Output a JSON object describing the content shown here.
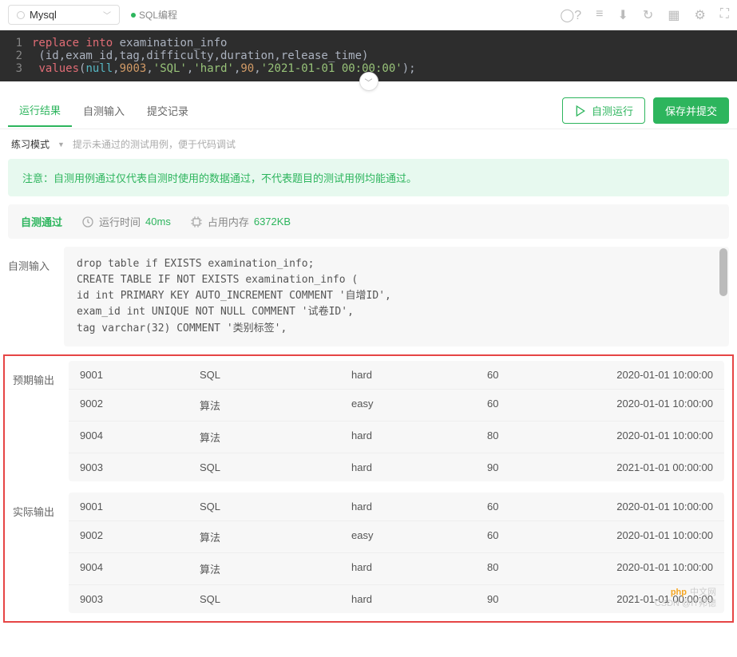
{
  "topbar": {
    "db_select": "Mysql",
    "lang_label": "SQL编程"
  },
  "editor": {
    "lines": [
      {
        "n": "1",
        "parts": [
          {
            "t": "replace",
            "c": "kw-red"
          },
          {
            "t": " ",
            "c": "plain"
          },
          {
            "t": "into",
            "c": "kw-red"
          },
          {
            "t": " examination_info",
            "c": "plain"
          }
        ]
      },
      {
        "n": "2",
        "parts": [
          {
            "t": " (id,exam_id,tag,difficulty,duration,release_time)",
            "c": "plain"
          }
        ]
      },
      {
        "n": "3",
        "parts": [
          {
            "t": " ",
            "c": "plain"
          },
          {
            "t": "values",
            "c": "kw-red"
          },
          {
            "t": "(",
            "c": "plain"
          },
          {
            "t": "null",
            "c": "kw-cyan"
          },
          {
            "t": ",",
            "c": "plain"
          },
          {
            "t": "9003",
            "c": "kw-orange"
          },
          {
            "t": ",",
            "c": "plain"
          },
          {
            "t": "'SQL'",
            "c": "kw-green"
          },
          {
            "t": ",",
            "c": "plain"
          },
          {
            "t": "'hard'",
            "c": "kw-green"
          },
          {
            "t": ",",
            "c": "plain"
          },
          {
            "t": "90",
            "c": "kw-orange"
          },
          {
            "t": ",",
            "c": "plain"
          },
          {
            "t": "'2021-01-01 00:00:00'",
            "c": "kw-green"
          },
          {
            "t": ");",
            "c": "plain"
          }
        ]
      }
    ]
  },
  "tabs": {
    "t1": "运行结果",
    "t2": "自测输入",
    "t3": "提交记录",
    "btn_run": "自测运行",
    "btn_submit": "保存并提交"
  },
  "mode": {
    "label": "练习模式",
    "hint": "提示未通过的测试用例，便于代码调试"
  },
  "notice": "注意：自测用例通过仅代表自测时使用的数据通过，不代表题目的测试用例均能通过。",
  "status": {
    "pass": "自测通过",
    "time_label": "运行时间",
    "time_value": "40ms",
    "mem_label": "占用内存",
    "mem_value": "6372KB"
  },
  "input": {
    "label": "自测输入",
    "lines": [
      "drop table if EXISTS examination_info;",
      "CREATE TABLE IF NOT EXISTS examination_info (",
      "id int PRIMARY KEY AUTO_INCREMENT COMMENT '自增ID',",
      "exam_id int UNIQUE NOT NULL COMMENT '试卷ID',",
      "tag varchar(32) COMMENT '类别标签',"
    ]
  },
  "expected": {
    "label": "预期输出",
    "rows": [
      [
        "9001",
        "SQL",
        "hard",
        "60",
        "2020-01-01 10:00:00"
      ],
      [
        "9002",
        "算法",
        "easy",
        "60",
        "2020-01-01 10:00:00"
      ],
      [
        "9004",
        "算法",
        "hard",
        "80",
        "2020-01-01 10:00:00"
      ],
      [
        "9003",
        "SQL",
        "hard",
        "90",
        "2021-01-01 00:00:00"
      ]
    ]
  },
  "actual": {
    "label": "实际输出",
    "rows": [
      [
        "9001",
        "SQL",
        "hard",
        "60",
        "2020-01-01 10:00:00"
      ],
      [
        "9002",
        "算法",
        "easy",
        "60",
        "2020-01-01 10:00:00"
      ],
      [
        "9004",
        "算法",
        "hard",
        "80",
        "2020-01-01 10:00:00"
      ],
      [
        "9003",
        "SQL",
        "hard",
        "90",
        "2021-01-01 00:00:00"
      ]
    ]
  },
  "watermark": {
    "logo": "php",
    "site": "中文网",
    "credit": "CSDN @IT邦德"
  }
}
